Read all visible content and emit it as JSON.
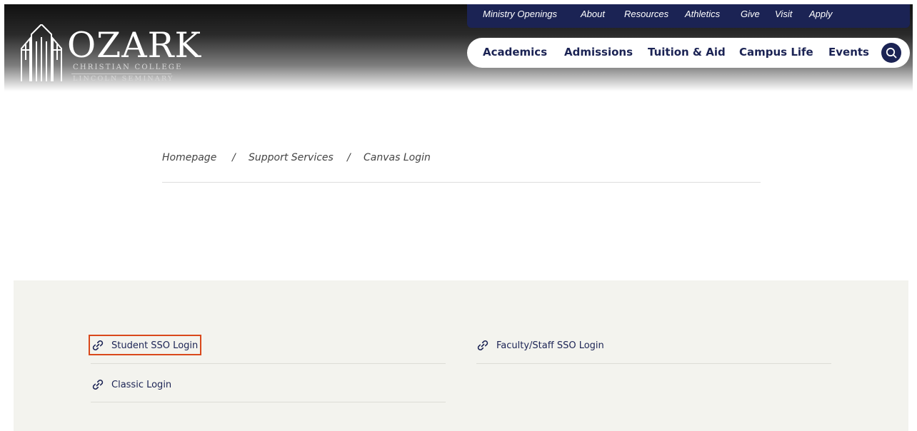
{
  "header": {
    "logo": {
      "wordmark": "OZARK",
      "line1": "CHRISTIAN COLLEGE",
      "line2": "LINCOLN SEMINARY"
    },
    "utility_nav": [
      "Ministry Openings",
      "About",
      "Resources",
      "Athletics",
      "Give",
      "Visit",
      "Apply"
    ],
    "main_nav": [
      "Academics",
      "Admissions",
      "Tuition & Aid",
      "Campus Life",
      "Events"
    ],
    "search_icon": "search-icon"
  },
  "breadcrumb": {
    "items": [
      "Homepage",
      "Support Services",
      "Canvas Login"
    ],
    "separator": "/"
  },
  "login_links": [
    {
      "label": "Student SSO Login",
      "icon": "link-icon",
      "highlighted": true
    },
    {
      "label": "Faculty/Staff SSO Login",
      "icon": "link-icon"
    },
    {
      "label": "Classic Login",
      "icon": "link-icon"
    }
  ],
  "colors": {
    "brand_navy": "#1b2354",
    "panel_bg": "#f3f3ee",
    "highlight": "#d9481b"
  }
}
